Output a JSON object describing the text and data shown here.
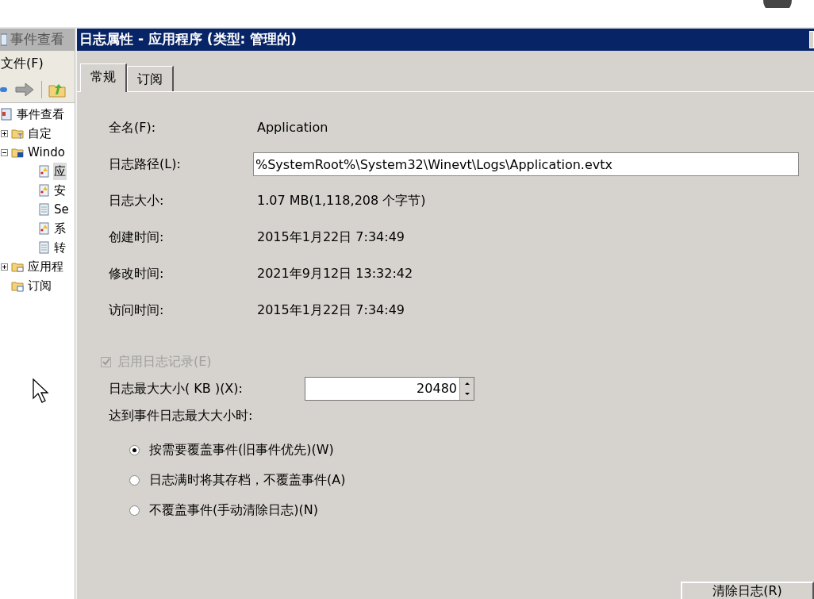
{
  "background_window": {
    "title": "事件查看",
    "menu": [
      "文件(F)"
    ],
    "tree": [
      {
        "label": "事件查看",
        "kind": "viewer",
        "children": [
          {
            "label": "自定",
            "kind": "filter-folder",
            "expanded": false
          },
          {
            "label": "Windo",
            "kind": "computer-folder",
            "expanded": true,
            "children": [
              {
                "label": "应",
                "kind": "log-warn",
                "selected": true
              },
              {
                "label": "安",
                "kind": "log-warn",
                "selected": false
              },
              {
                "label": "Se",
                "kind": "log",
                "selected": false
              },
              {
                "label": "系",
                "kind": "log-warn",
                "selected": false
              },
              {
                "label": "转",
                "kind": "log",
                "selected": false
              }
            ]
          },
          {
            "label": "应用程",
            "kind": "app-folder",
            "expanded": false
          },
          {
            "label": "订阅",
            "kind": "sub-folder"
          }
        ]
      }
    ]
  },
  "dialog": {
    "title": "日志属性 - 应用程序 (类型: 管理的)",
    "tabs": [
      {
        "label": "常规",
        "selected": true
      },
      {
        "label": "订阅",
        "selected": false
      }
    ],
    "fields": [
      {
        "label": "全名(F):",
        "value": "Application",
        "kind": "text"
      },
      {
        "label": "日志路径(L):",
        "value": "%SystemRoot%\\System32\\Winevt\\Logs\\Application.evtx",
        "kind": "input"
      },
      {
        "label": "日志大小:",
        "value": "1.07 MB(1,118,208 个字节)",
        "kind": "text"
      },
      {
        "label": "创建时间:",
        "value": "2015年1月22日 7:34:49",
        "kind": "text"
      },
      {
        "label": "修改时间:",
        "value": "2021年9月12日 13:32:42",
        "kind": "text"
      },
      {
        "label": "访问时间:",
        "value": "2015年1月22日 7:34:49",
        "kind": "text"
      }
    ],
    "enable_logging": {
      "label": "启用日志记录(E)",
      "checked": true,
      "disabled": true
    },
    "max_size": {
      "label": "日志最大大小( KB )(X):",
      "value": "20480"
    },
    "policy_label": "达到事件日志最大大小时:",
    "policy_options": [
      {
        "label": "按需要覆盖事件(旧事件优先)(W)",
        "selected": true
      },
      {
        "label": "日志满时将其存档，不覆盖事件(A)",
        "selected": false
      },
      {
        "label": "不覆盖事件(手动清除日志)(N)",
        "selected": false
      }
    ],
    "clear_button": "清除日志(R)"
  }
}
